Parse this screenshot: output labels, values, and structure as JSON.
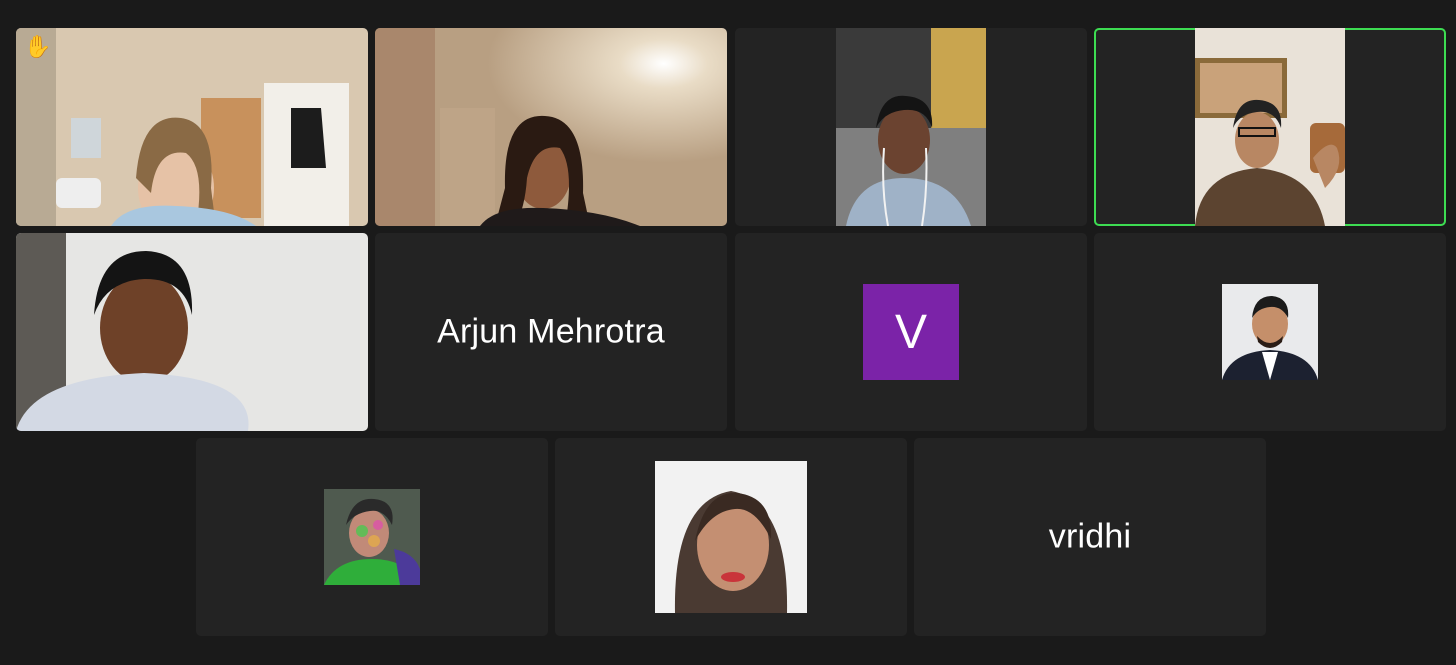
{
  "meeting": {
    "theme": {
      "background": "#1a1a1a",
      "tile": "#232323",
      "active_speaker_border": "#3ddc52"
    },
    "participants": [
      {
        "type": "video",
        "hand_raised": true,
        "hand_icon": "raised-hand-icon"
      },
      {
        "type": "video"
      },
      {
        "type": "video"
      },
      {
        "type": "video",
        "active_speaker": true
      },
      {
        "type": "video"
      },
      {
        "type": "name",
        "display_name": "Arjun Mehrotra"
      },
      {
        "type": "avatar_letter",
        "letter": "V",
        "color": "#7b23a8"
      },
      {
        "type": "profile_photo"
      },
      {
        "type": "profile_photo"
      },
      {
        "type": "profile_photo"
      },
      {
        "type": "name",
        "display_name": "vridhi"
      }
    ]
  }
}
